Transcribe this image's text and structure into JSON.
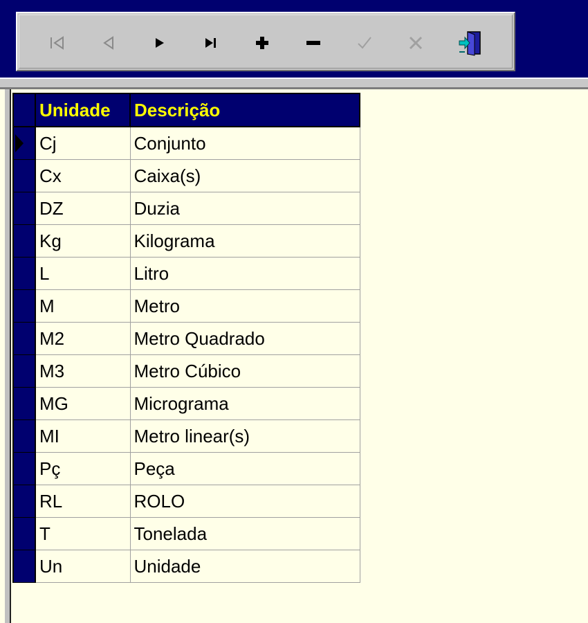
{
  "toolbar": {
    "buttons": [
      {
        "name": "first-record-icon",
        "enabled": false
      },
      {
        "name": "prior-record-icon",
        "enabled": false
      },
      {
        "name": "next-record-icon",
        "enabled": true
      },
      {
        "name": "last-record-icon",
        "enabled": true
      },
      {
        "name": "insert-record-icon",
        "enabled": true
      },
      {
        "name": "delete-record-icon",
        "enabled": true
      },
      {
        "name": "post-edit-icon",
        "enabled": false
      },
      {
        "name": "cancel-edit-icon",
        "enabled": false
      },
      {
        "name": "exit-door-icon",
        "enabled": true
      }
    ]
  },
  "grid": {
    "headers": [
      "Unidade",
      "Descrição"
    ],
    "rows": [
      {
        "unidade": "Cj",
        "descricao": "Conjunto"
      },
      {
        "unidade": "Cx",
        "descricao": "Caixa(s)"
      },
      {
        "unidade": "DZ",
        "descricao": "Duzia"
      },
      {
        "unidade": "Kg",
        "descricao": "Kilograma"
      },
      {
        "unidade": "L",
        "descricao": "Litro"
      },
      {
        "unidade": "M",
        "descricao": "Metro"
      },
      {
        "unidade": "M2",
        "descricao": "Metro Quadrado"
      },
      {
        "unidade": "M3",
        "descricao": "Metro Cúbico"
      },
      {
        "unidade": "MG",
        "descricao": "Micrograma"
      },
      {
        "unidade": "MI",
        "descricao": "Metro linear(s)"
      },
      {
        "unidade": "Pç",
        "descricao": "Peça"
      },
      {
        "unidade": "RL",
        "descricao": "ROLO"
      },
      {
        "unidade": "T",
        "descricao": "Tonelada"
      },
      {
        "unidade": "Un",
        "descricao": "Unidade"
      }
    ]
  },
  "colors": {
    "title_band": "#00006f",
    "header_text": "#ffff00",
    "grid_background": "#ffffe8",
    "toolbar_face": "#c8c8c8"
  }
}
